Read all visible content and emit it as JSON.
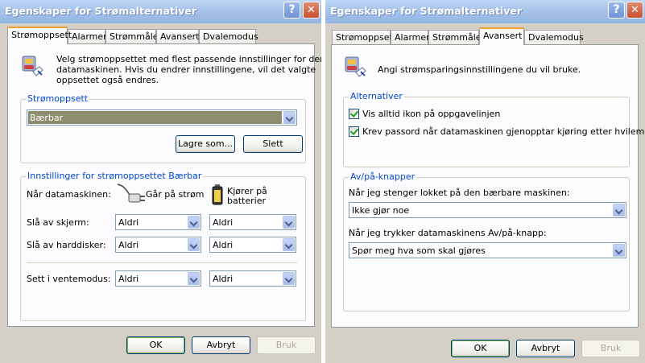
{
  "left": {
    "title": "Egenskaper for Strømalternativer",
    "tabs": [
      "Strømoppsett",
      "Alarmer",
      "Strømmåler",
      "Avansert",
      "Dvalemodus"
    ],
    "intro": [
      "Velg strømoppsettet med flest passende innstillinger for denne",
      "datamaskinen. Hvis du endrer innstillingene, vil det valgte",
      "oppsettet også endres."
    ],
    "scheme_group": "Strømoppsett",
    "scheme_value": "Bærbar",
    "save_as": "Lagre som...",
    "delete": "Slett",
    "settings_group": "Innstillinger for strømoppsettet Bærbar",
    "when_label": "Når datamaskinen:",
    "ac_label": "Går på strøm",
    "battery_label": [
      "Kjører på",
      "batterier"
    ],
    "rows": [
      {
        "label": "Slå av skjerm:",
        "ac": "Aldri",
        "battery": "Aldri"
      },
      {
        "label": "Slå av harddisker:",
        "ac": "Aldri",
        "battery": "Aldri"
      },
      {
        "label": "Sett i ventemodus:",
        "ac": "Aldri",
        "battery": "Aldri"
      }
    ],
    "ok": "OK",
    "cancel": "Avbryt",
    "apply": "Bruk"
  },
  "right": {
    "title": "Egenskaper for Strømalternativer",
    "tabs": [
      "Strømoppsett",
      "Alarmer",
      "Strømmåler",
      "Avansert",
      "Dvalemodus"
    ],
    "intro": "Angi strømsparingsinnstillingene du vil bruke.",
    "alt_group": "Alternativer",
    "checkboxes": [
      {
        "label": "Vis alltid ikon på oppgavelinjen",
        "checked": true
      },
      {
        "label": "Krev passord når datamaskinen gjenopptar kjøring etter hvilemodus",
        "checked": true
      }
    ],
    "buttons_group": "Av/på-knapper",
    "lid_label": "Når jeg stenger lokket på den bærbare maskinen:",
    "lid_value": "Ikke gjør noe",
    "power_label": "Når jeg trykker datamaskinens Av/på-knapp:",
    "power_value": "Spør meg hva som skal gjøres",
    "ok": "OK",
    "cancel": "Avbryt",
    "apply": "Bruk"
  }
}
